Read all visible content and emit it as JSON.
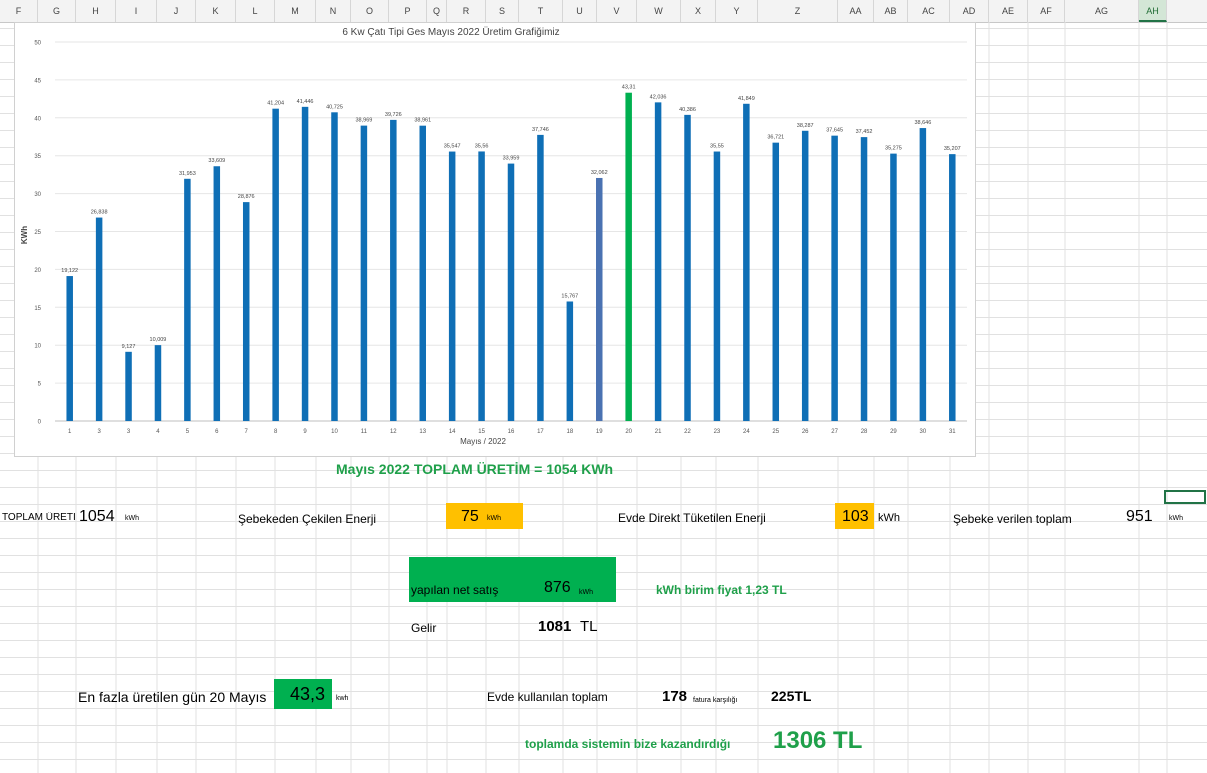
{
  "columns": [
    "F",
    "G",
    "H",
    "I",
    "J",
    "K",
    "L",
    "M",
    "N",
    "O",
    "P",
    "Q",
    "R",
    "S",
    "T",
    "U",
    "V",
    "W",
    "X",
    "Y",
    "Z",
    "AA",
    "AB",
    "AC",
    "AD",
    "AE",
    "AF",
    "AG",
    "AH"
  ],
  "active_column": "AH",
  "chart_data": {
    "type": "bar",
    "title": "6 Kw Çatı Tipi Ges Mayıs 2022 Üretim Grafiğimiz",
    "xlabel": "Mayıs  / 2022",
    "ylabel": "KWh",
    "ylim": [
      0,
      50
    ],
    "yticks": [
      0,
      5,
      10,
      15,
      20,
      25,
      30,
      35,
      40,
      45,
      50
    ],
    "grid": true,
    "categories": [
      "1",
      "3",
      "3",
      "4",
      "5",
      "6",
      "7",
      "8",
      "9",
      "10",
      "11",
      "12",
      "13",
      "14",
      "15",
      "16",
      "17",
      "18",
      "19",
      "20",
      "21",
      "22",
      "23",
      "24",
      "25",
      "26",
      "27",
      "28",
      "29",
      "30",
      "31"
    ],
    "values": [
      19.122,
      26.838,
      9.127,
      10.009,
      31.953,
      33.609,
      28.876,
      41.204,
      41.446,
      40.725,
      38.969,
      39.726,
      38.961,
      35.547,
      35.56,
      33.959,
      37.746,
      15.767,
      32.062,
      43.31,
      42.036,
      40.386,
      35.55,
      41.849,
      36.721,
      38.287,
      37.645,
      37.452,
      35.275,
      38.646,
      35.207
    ],
    "value_labels": [
      "19,122",
      "26,838",
      "9,127",
      "10,009",
      "31,953",
      "33,609",
      "28,876",
      "41,204",
      "41,446",
      "40,725",
      "38,969",
      "39,726",
      "38,961",
      "35,547",
      "35,56",
      "33,959",
      "37,746",
      "15,767",
      "32,062",
      "43,31",
      "42,036",
      "40,386",
      "35,55",
      "41,849",
      "36,721",
      "38,287",
      "37,645",
      "37,452",
      "35,275",
      "38,646",
      "35,207"
    ],
    "colors": {
      "default": "#0f6fb6",
      "day19": "#4a72b2",
      "day20": "#00b050"
    }
  },
  "summary": {
    "total_title": "Mayıs 2022 TOPLAM ÜRETİM = 1054 KWh",
    "total_label": "TOPLAM ÜRETİM",
    "total_value": "1054",
    "total_unit": "kWh",
    "grid_drawn_label": "Şebekeden Çekilen Enerji",
    "grid_drawn_value": "75",
    "grid_drawn_unit": "kWh",
    "direct_label": "Evde Direkt Tüketilen Enerji",
    "direct_value": "103",
    "direct_unit": "kWh",
    "fed_label": "Şebeke verilen toplam",
    "fed_value": "951",
    "fed_unit": "kWh",
    "net_sale_label": "yapılan net satış",
    "net_sale_value": "876",
    "net_sale_unit": "kWh",
    "unit_price": "kWh birim fiyat 1,23 TL",
    "income_label": "Gelir",
    "income_value": "1081",
    "income_unit": "TL",
    "max_day_label": "En fazla üretilen gün 20 Mayıs",
    "max_day_value": "43,3",
    "max_day_unit": "kwh",
    "home_total_label": "Evde kullanılan toplam",
    "home_total_value": "178",
    "bill_label": "fatura karşılığı",
    "bill_value": "225TL",
    "earned_label": "toplamda sistemin bize kazandırdığı",
    "earned_value": "1306 TL"
  },
  "colors": {
    "green_fill": "#00b050",
    "orange_fill": "#ffc000",
    "green_text": "#1fa04a",
    "excel_green": "#217346"
  }
}
